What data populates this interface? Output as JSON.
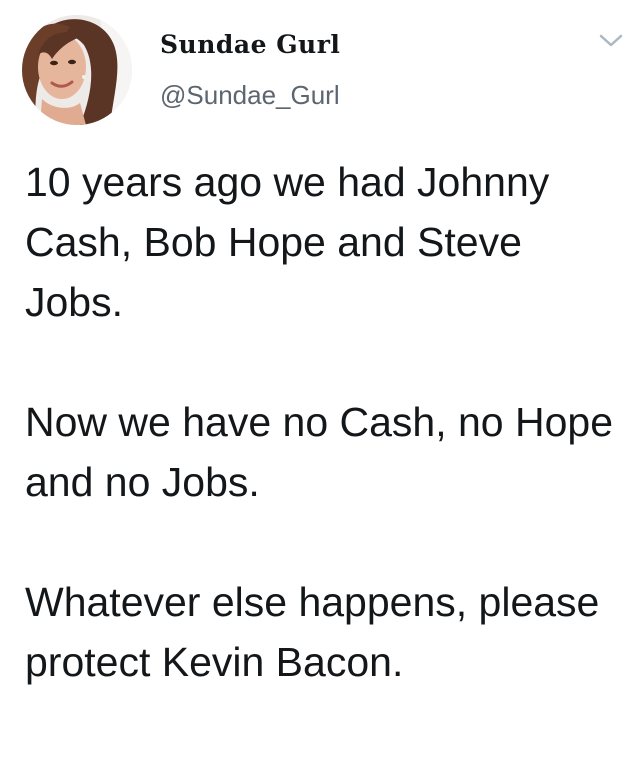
{
  "author": {
    "display_name": "Sundae Gurl",
    "handle": "@Sundae_Gurl",
    "avatar_icon": "profile-photo"
  },
  "menu": {
    "icon": "chevron-down-icon",
    "color": "#aab8c2"
  },
  "tweet": {
    "paragraphs": [
      "10 years ago we had Johnny Cash, Bob Hope and Steve Jobs.",
      "Now we have no Cash, no Hope and no Jobs.",
      "Whatever else happens, please protect Kevin Bacon."
    ]
  }
}
